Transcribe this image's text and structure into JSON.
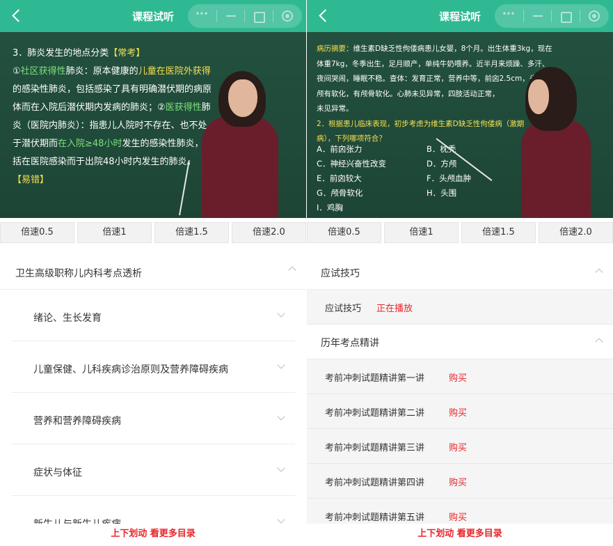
{
  "left": {
    "header": {
      "title": "课程试听"
    },
    "video": {
      "lines": [
        {
          "parts": [
            {
              "t": "3．肺炎发生的地点分类",
              "c": ""
            },
            {
              "t": "【常考】",
              "c": "y"
            }
          ]
        },
        {
          "parts": [
            {
              "t": "①",
              "c": ""
            },
            {
              "t": "社区获得性",
              "c": "g"
            },
            {
              "t": "肺炎：原本健康的",
              "c": ""
            },
            {
              "t": "儿童在医院外获得",
              "c": "y"
            }
          ]
        },
        {
          "parts": [
            {
              "t": "的感染性肺炎，包括感染了具有明确潜伏期的病原",
              "c": ""
            }
          ]
        },
        {
          "parts": [
            {
              "t": "体而在入院后潜伏期内发病的肺炎；②",
              "c": ""
            },
            {
              "t": "医获得性",
              "c": "g"
            },
            {
              "t": "肺",
              "c": ""
            }
          ]
        },
        {
          "parts": [
            {
              "t": "炎（医院内肺炎）：指患儿人院时不存在、也不处",
              "c": ""
            }
          ]
        },
        {
          "parts": [
            {
              "t": "于潜伏期而",
              "c": ""
            },
            {
              "t": "在入院≥48小时",
              "c": "g"
            },
            {
              "t": "发生的感染性肺炎，包",
              "c": ""
            }
          ]
        },
        {
          "parts": [
            {
              "t": "括在医院感染而于出院48小时内发生的肺炎。",
              "c": ""
            }
          ]
        },
        {
          "parts": [
            {
              "t": "【易错】",
              "c": "y"
            }
          ]
        }
      ]
    },
    "speeds": [
      "倍速0.5",
      "倍速1",
      "倍速1.5",
      "倍速2.0"
    ],
    "course_title": "卫生高级职称儿内科考点透析",
    "chapters": [
      "绪论、生长发育",
      "儿童保健、儿科疾病诊治原则及营养障碍疾病",
      "营养和营养障碍疾病",
      "症状与体征",
      "新生儿与新生儿疾病"
    ],
    "hint": "上下划动 看更多目录"
  },
  "right": {
    "header": {
      "title": "课程试听"
    },
    "video": {
      "lines": [
        {
          "parts": [
            {
              "t": "病历摘要：",
              "c": "y"
            },
            {
              "t": "维生素D缺乏性佝偻病患儿女婴，8个月。出生体重3kg，现在",
              "c": ""
            }
          ]
        },
        {
          "parts": [
            {
              "t": "体重7kg，冬季出生，足月顺产，单纯牛奶喂养。近半月来烦躁、多汗、",
              "c": ""
            }
          ]
        },
        {
          "parts": [
            {
              "t": "夜间哭闹，睡眠不稳。查体：发育正常，营养中等，前囟2.5cm，头",
              "c": ""
            }
          ]
        },
        {
          "parts": [
            {
              "t": "颅有软化，有颅骨软化。心肺未见异常，四肢活动正常，",
              "c": ""
            }
          ]
        },
        {
          "parts": [
            {
              "t": "未见异常。",
              "c": ""
            }
          ]
        },
        {
          "parts": [
            {
              "t": "2．根据患儿临床表现，初步考虑为维生素D缺乏性佝偻病（激期",
              "c": "q"
            }
          ]
        },
        {
          "parts": [
            {
              "t": "病），下列哪项符合？",
              "c": "q"
            }
          ]
        }
      ],
      "options_left": [
        "A．前囟张力",
        "C．神经兴奋性改变",
        "E．前囟较大",
        "G．颅骨软化",
        "I．鸡胸"
      ],
      "options_right": [
        "B．枕秃",
        "D．方颅",
        "F．头颅血肿",
        "H．头围"
      ]
    },
    "speeds": [
      "倍速0.5",
      "倍速1",
      "倍速1.5",
      "倍速2.0"
    ],
    "sections": [
      {
        "title": "应试技巧",
        "items": [
          {
            "label": "应试技巧",
            "tag": "正在播放"
          }
        ]
      },
      {
        "title": "历年考点精讲",
        "items": [
          {
            "label": "考前冲刺试题精讲第一讲",
            "tag": "购买"
          },
          {
            "label": "考前冲刺试题精讲第二讲",
            "tag": "购买"
          },
          {
            "label": "考前冲刺试题精讲第三讲",
            "tag": "购买"
          },
          {
            "label": "考前冲刺试题精讲第四讲",
            "tag": "购买"
          },
          {
            "label": "考前冲刺试题精讲第五讲",
            "tag": "购买"
          }
        ]
      }
    ],
    "hint": "上下划动 看更多目录"
  },
  "colors": {
    "header_green": "#2fb993",
    "board_green": "#23503f",
    "red": "#e6262a"
  }
}
